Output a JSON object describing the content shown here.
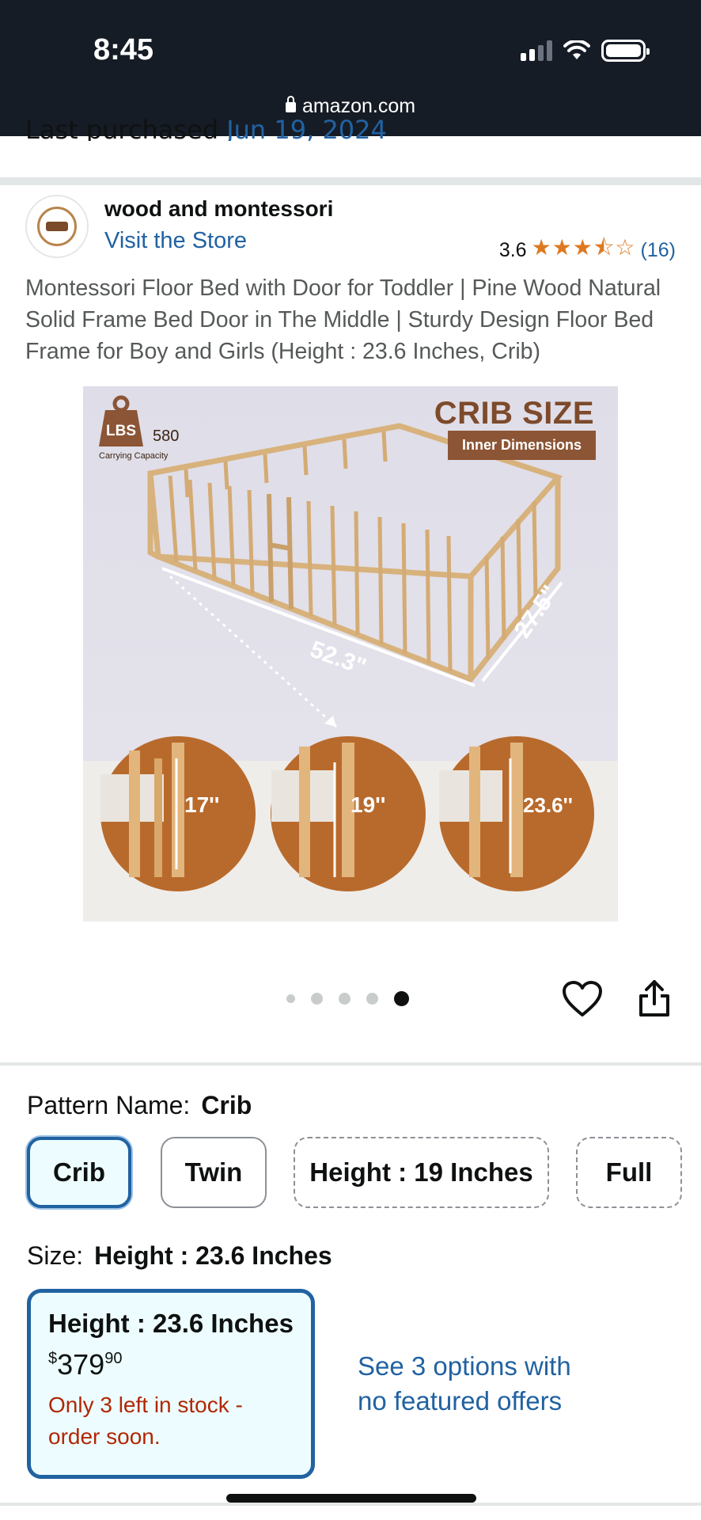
{
  "status_bar": {
    "time": "8:45",
    "url": "amazon.com",
    "icons": [
      "signal-icon",
      "wifi-icon",
      "battery-icon"
    ]
  },
  "last_purchased": {
    "label": "Last purchased",
    "date": "Jun 19, 2024"
  },
  "store": {
    "name": "wood and montessori",
    "link_label": "Visit the Store"
  },
  "rating": {
    "value": "3.6",
    "stars": 3.5,
    "count": "(16)"
  },
  "product_title": "Montessori Floor Bed with Door for Toddler | Pine Wood Natural Solid Frame Bed Door in The Middle | Sturdy Design Floor Bed Frame for Boy and Girls (Height : 23.6 Inches, Crib)",
  "product_image": {
    "heading": "CRIB SIZE",
    "subheading": "Inner Dimensions",
    "weight_badge": "LBS",
    "weight_value": "580",
    "weight_caption": "Carrying Capacity",
    "length_label": "52.3\"",
    "width_label": "27.5\"",
    "heights": [
      "17''",
      "19''",
      "23.6''"
    ]
  },
  "carousel": {
    "count": 5,
    "active_index": 4
  },
  "pattern": {
    "label": "Pattern Name:",
    "selected": "Crib",
    "options": [
      "Crib",
      "Twin",
      "Height : 19 Inches",
      "Full"
    ]
  },
  "size": {
    "label": "Size:",
    "selected": "Height : 23.6 Inches",
    "card": {
      "name": "Height : 23.6 Inches",
      "price_symbol": "$",
      "price_whole": "379",
      "price_fraction": "90",
      "stock_line1": "Only 3 left in stock -",
      "stock_line2": "order soon."
    },
    "other_offers_line1": "See 3 options with",
    "other_offers_line2": "no featured offers"
  },
  "colors": {
    "link": "#2162a1",
    "star": "#de7921",
    "stock_warning": "#b12704",
    "selected_bg": "#edfdff",
    "status_bar_bg": "#161c26"
  }
}
